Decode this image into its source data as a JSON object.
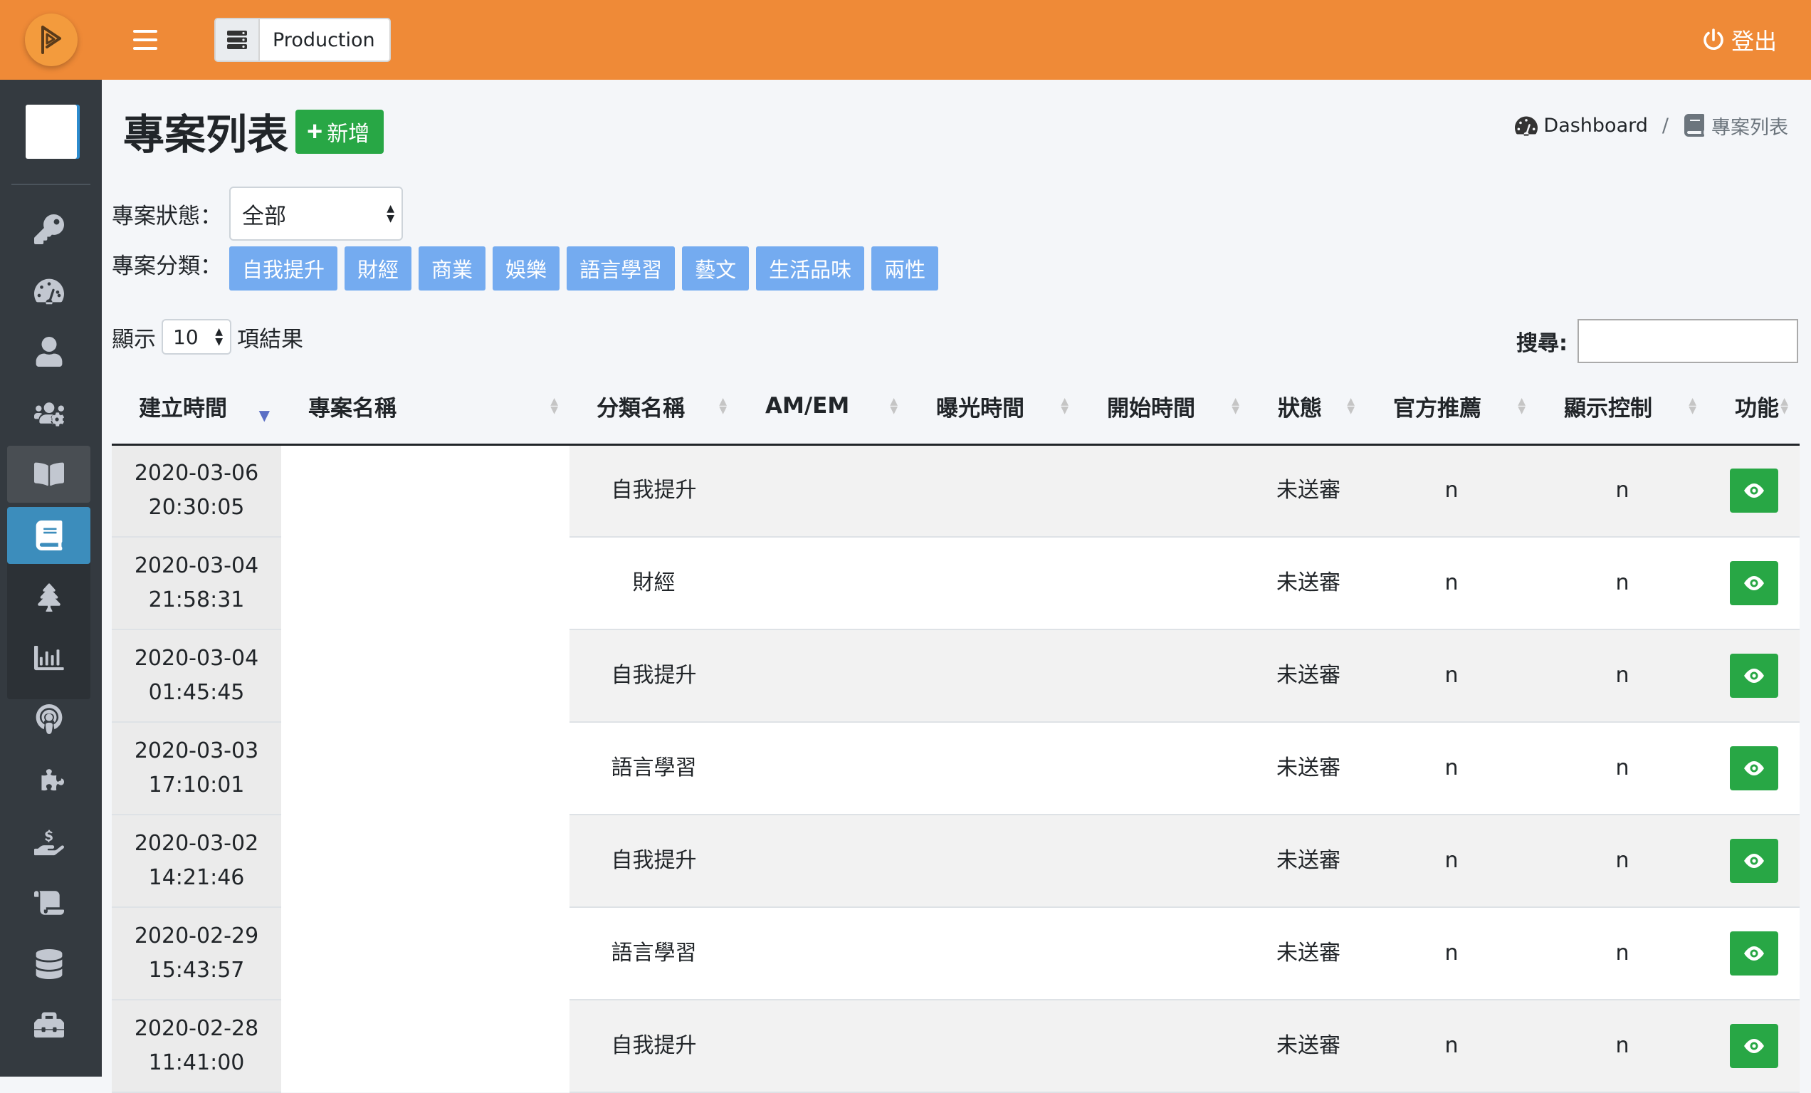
{
  "header": {
    "environment": "Production",
    "logout_label": "登出"
  },
  "sidebar": {
    "items": [
      {
        "icon": "key-icon"
      },
      {
        "icon": "tachometer-icon"
      },
      {
        "icon": "user-icon"
      },
      {
        "icon": "users-cog-icon"
      },
      {
        "icon": "book-open-icon"
      },
      {
        "icon": "book-icon"
      },
      {
        "icon": "tree-icon"
      },
      {
        "icon": "chart-bar-icon"
      },
      {
        "icon": "podcast-icon"
      },
      {
        "icon": "puzzle-piece-icon"
      },
      {
        "icon": "hand-holding-usd-icon"
      },
      {
        "icon": "scroll-icon"
      },
      {
        "icon": "database-icon"
      },
      {
        "icon": "toolbox-icon"
      }
    ]
  },
  "page": {
    "title": "專案列表",
    "add_label": "新增",
    "breadcrumb": {
      "home": "Dashboard",
      "separator": "/",
      "current": "專案列表"
    }
  },
  "filters": {
    "status_label": "專案狀態：",
    "status_value": "全部",
    "category_label": "專案分類：",
    "categories": [
      "自我提升",
      "財經",
      "商業",
      "娛樂",
      "語言學習",
      "藝文",
      "生活品味",
      "兩性"
    ]
  },
  "table_controls": {
    "show_prefix": "顯示",
    "page_length": "10",
    "show_suffix": "項結果",
    "search_label": "搜尋:"
  },
  "table": {
    "columns": [
      "建立時間",
      "專案名稱",
      "分類名稱",
      "AM/EM",
      "曝光時間",
      "開始時間",
      "狀態",
      "官方推薦",
      "顯示控制",
      "功能"
    ],
    "rows": [
      {
        "date": "2020-03-06",
        "time": "20:30:05",
        "name": "",
        "category": "自我提升",
        "amem": "",
        "exposure": "",
        "start": "",
        "status": "未送審",
        "official": "n",
        "display": "n"
      },
      {
        "date": "2020-03-04",
        "time": "21:58:31",
        "name": "",
        "category": "財經",
        "amem": "",
        "exposure": "",
        "start": "",
        "status": "未送審",
        "official": "n",
        "display": "n"
      },
      {
        "date": "2020-03-04",
        "time": "01:45:45",
        "name": "",
        "category": "自我提升",
        "amem": "",
        "exposure": "",
        "start": "",
        "status": "未送審",
        "official": "n",
        "display": "n"
      },
      {
        "date": "2020-03-03",
        "time": "17:10:01",
        "name": "",
        "category": "語言學習",
        "amem": "",
        "exposure": "",
        "start": "",
        "status": "未送審",
        "official": "n",
        "display": "n"
      },
      {
        "date": "2020-03-02",
        "time": "14:21:46",
        "name": "",
        "category": "自我提升",
        "amem": "",
        "exposure": "",
        "start": "",
        "status": "未送審",
        "official": "n",
        "display": "n"
      },
      {
        "date": "2020-02-29",
        "time": "15:43:57",
        "name": "",
        "category": "語言學習",
        "amem": "",
        "exposure": "",
        "start": "",
        "status": "未送審",
        "official": "n",
        "display": "n"
      },
      {
        "date": "2020-02-28",
        "time": "11:41:00",
        "name": "",
        "category": "自我提升",
        "amem": "",
        "exposure": "",
        "start": "",
        "status": "未送審",
        "official": "n",
        "display": "n"
      }
    ]
  },
  "colors": {
    "header_orange": "#ef8a37",
    "sidebar_dark": "#343a40",
    "active_blue": "#3c8dbc",
    "success_green": "#28a745",
    "category_blue": "#74abf0"
  }
}
